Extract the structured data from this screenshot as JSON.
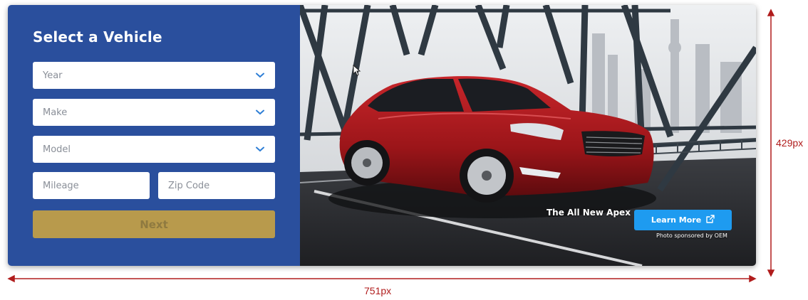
{
  "form": {
    "title": "Select a Vehicle",
    "year_placeholder": "Year",
    "make_placeholder": "Make",
    "model_placeholder": "Model",
    "mileage_placeholder": "Mileage",
    "zip_placeholder": "Zip Code",
    "next_label": "Next"
  },
  "promo": {
    "headline": "The All New Apex",
    "cta_label": "Learn More",
    "credit": "Photo sponsored by OEM"
  },
  "annotations": {
    "width_label": "751px",
    "height_label": "429px"
  },
  "colors": {
    "panel": "#2a4f9d",
    "next_button": "#b89a4c",
    "cta": "#1e9bf0",
    "annotation": "#b01c1c",
    "car": "#a8191e"
  },
  "icons": {
    "dropdown": "chevron-down-icon",
    "external": "external-link-icon"
  }
}
